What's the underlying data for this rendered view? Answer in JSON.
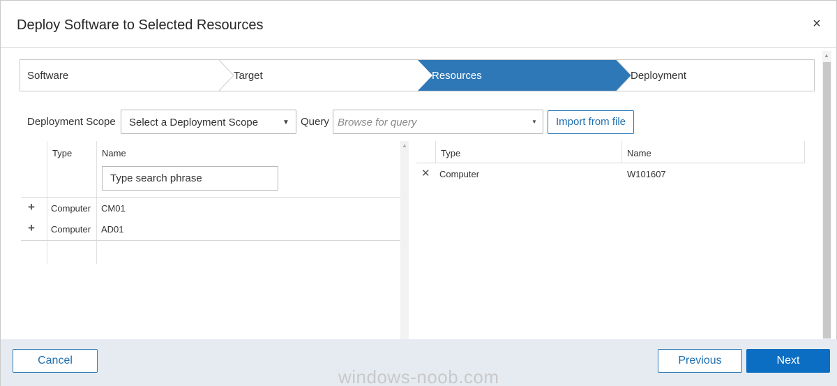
{
  "dialog": {
    "title": "Deploy Software to Selected Resources",
    "close_glyph": "×"
  },
  "steps": [
    {
      "label": "Software",
      "active": false
    },
    {
      "label": "Target",
      "active": false
    },
    {
      "label": "Resources",
      "active": true
    },
    {
      "label": "Deployment",
      "active": false
    }
  ],
  "colors": {
    "accent": "#2e7ab8",
    "step_active": "#2f78b7",
    "primary_button": "#0b6ec2",
    "footer_bg": "#e5ebf1"
  },
  "scope": {
    "label": "Deployment Scope",
    "select_value": "Select a Deployment Scope",
    "query_label": "Query",
    "query_placeholder": "Browse for query",
    "import_button": "Import from file"
  },
  "available": {
    "columns": {
      "type": "Type",
      "name": "Name"
    },
    "search_placeholder": "Type search phrase",
    "rows": [
      {
        "action_icon": "plus-icon",
        "action_glyph": "+",
        "type": "Computer",
        "name": "CM01"
      },
      {
        "action_icon": "plus-icon",
        "action_glyph": "+",
        "type": "Computer",
        "name": "AD01"
      }
    ]
  },
  "selected": {
    "columns": {
      "type": "Type",
      "name": "Name"
    },
    "rows": [
      {
        "action_icon": "remove-icon",
        "action_glyph": "✕",
        "type": "Computer",
        "name": "W101607"
      }
    ]
  },
  "footer": {
    "cancel": "Cancel",
    "previous": "Previous",
    "next": "Next"
  },
  "watermark": "windows-noob.com"
}
